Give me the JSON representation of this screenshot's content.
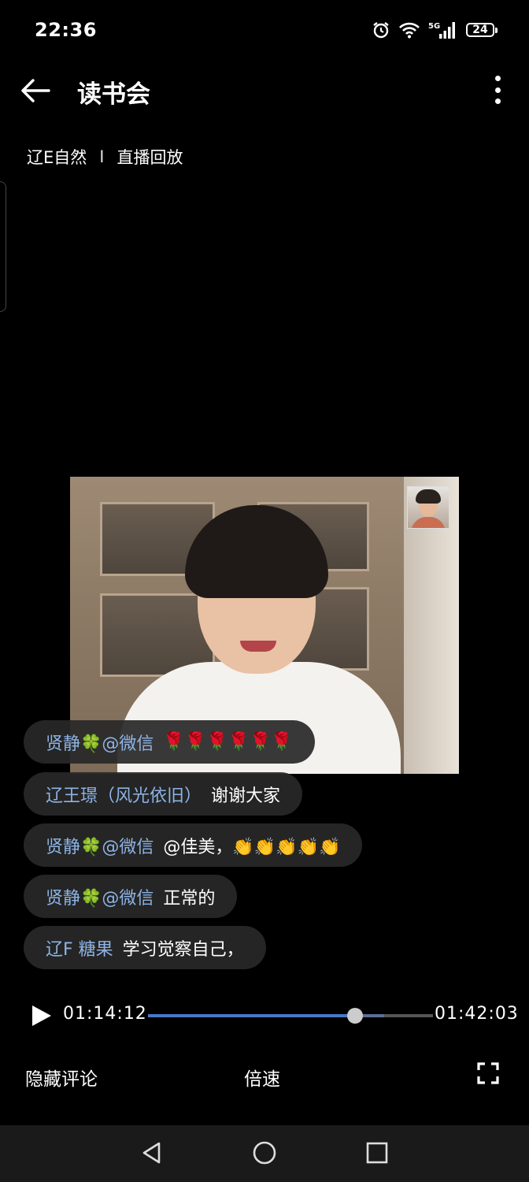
{
  "status_bar": {
    "time": "22:36",
    "battery": "24",
    "network": "5G"
  },
  "header": {
    "title": "读书会"
  },
  "subtitle": {
    "channel": "辽E自然",
    "separator": "I",
    "mode": "直播回放"
  },
  "comments": [
    {
      "user": "贤静🍀@微信",
      "text": "🌹🌹🌹🌹🌹🌹"
    },
    {
      "user": "辽王璟（风光依旧）",
      "text": "谢谢大家"
    },
    {
      "user": "贤静🍀@微信",
      "text": "@佳美，👏👏👏👏👏"
    },
    {
      "user": "贤静🍀@微信",
      "text": "正常的"
    },
    {
      "user": "辽F 糖果",
      "text": "学习觉察自己，"
    }
  ],
  "player": {
    "current_time": "01:14:12",
    "total_time": "01:42:03",
    "progress": 0.727,
    "buffered": 0.83
  },
  "controls": {
    "hide_comments": "隐藏评论",
    "speed": "倍速"
  },
  "colors": {
    "background": "#000000",
    "username": "#8db4e6",
    "progress": "#4a78c8",
    "bubble": "#282828"
  }
}
